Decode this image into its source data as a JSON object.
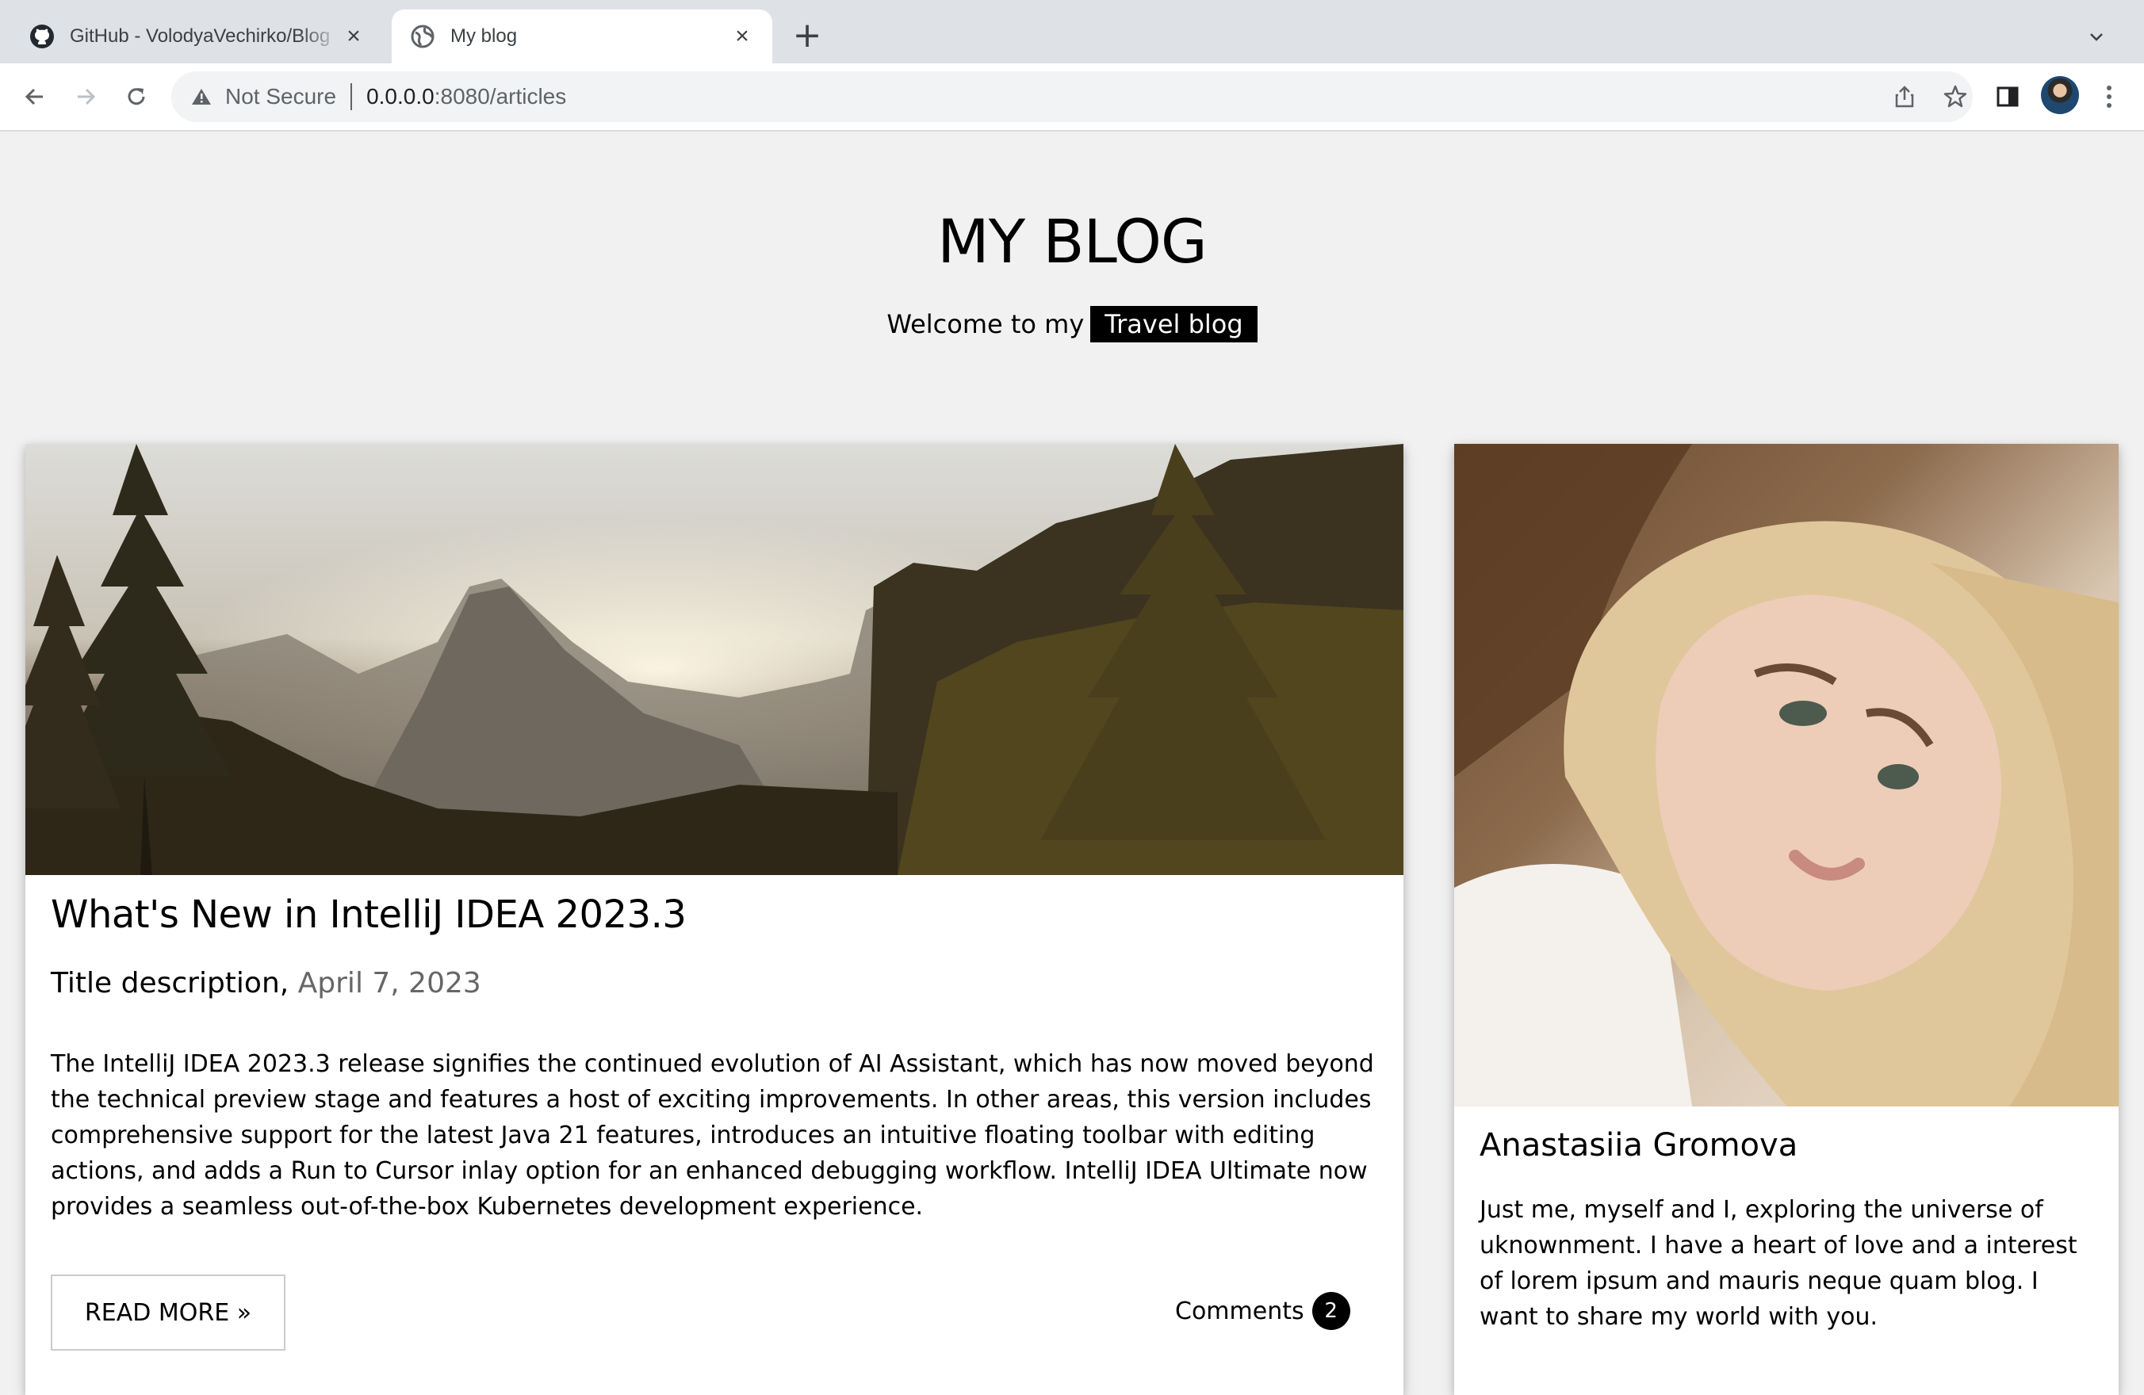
{
  "browser": {
    "tabs": [
      {
        "title": "GitHub - VolodyaVechirko/Blog",
        "icon": "github-icon",
        "active": false
      },
      {
        "title": "My blog",
        "icon": "globe-icon",
        "active": true
      }
    ],
    "new_tab_label": "+",
    "security_label": "Not Secure",
    "url_host": "0.0.0.0",
    "url_path": ":8080/articles"
  },
  "page": {
    "title": "MY BLOG",
    "welcome_prefix": "Welcome to my",
    "welcome_badge": "Travel blog"
  },
  "article": {
    "title": "What's New in IntelliJ IDEA 2023.3",
    "subtitle": "Title description,",
    "date": "April 7, 2023",
    "excerpt": "The IntelliJ IDEA 2023.3 release signifies the continued evolution of AI Assistant, which has now moved beyond the technical preview stage and features a host of exciting improvements. In other areas, this version includes comprehensive support for the latest Java 21 features, introduces an intuitive floating toolbar with editing actions, and adds a Run to Cursor inlay option for an enhanced debugging workflow. IntelliJ IDEA Ultimate now provides a seamless out-of-the-box Kubernetes development experience.",
    "read_more": "READ MORE »",
    "comments_label": "Comments",
    "comments_count": "2"
  },
  "profile": {
    "name": "Anastasiia Gromova",
    "bio": "Just me, myself and I, exploring the universe of uknownment. I have a heart of love and a interest of lorem ipsum and mauris neque quam blog. I want to share my world with you."
  }
}
